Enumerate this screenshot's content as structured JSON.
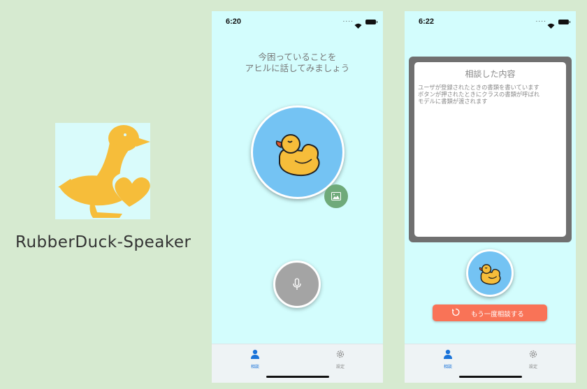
{
  "app": {
    "name": "RubberDuck-Speaker"
  },
  "screen1": {
    "time": "6:20",
    "signal": "....",
    "prompt_line1": "今困っていることを",
    "prompt_line2": "アヒルに話してみましょう"
  },
  "screen2": {
    "time": "6:22",
    "signal": "....",
    "card_title": "相談した内容",
    "card_lines": [
      "ユーザが登録されたときの書類を書いています",
      "ボタンが押されたときにクラスの書類が呼ばれ",
      "モデルに書類が渡されます"
    ],
    "again_label": "もう一度相談する"
  },
  "tabs": [
    {
      "label": "相談",
      "icon": "person-icon",
      "active": true
    },
    {
      "label": "設定",
      "icon": "gear-icon",
      "active": false
    }
  ],
  "colors": {
    "background": "#d6ead0",
    "screen": "#d3fdfd",
    "duck": "#f6bd3a",
    "duck_circle": "#74c3f3",
    "tab_active": "#1a73d9",
    "again_button": "#f97357",
    "photo_button": "#6faa7a",
    "mic_button": "#a4a4a4"
  }
}
